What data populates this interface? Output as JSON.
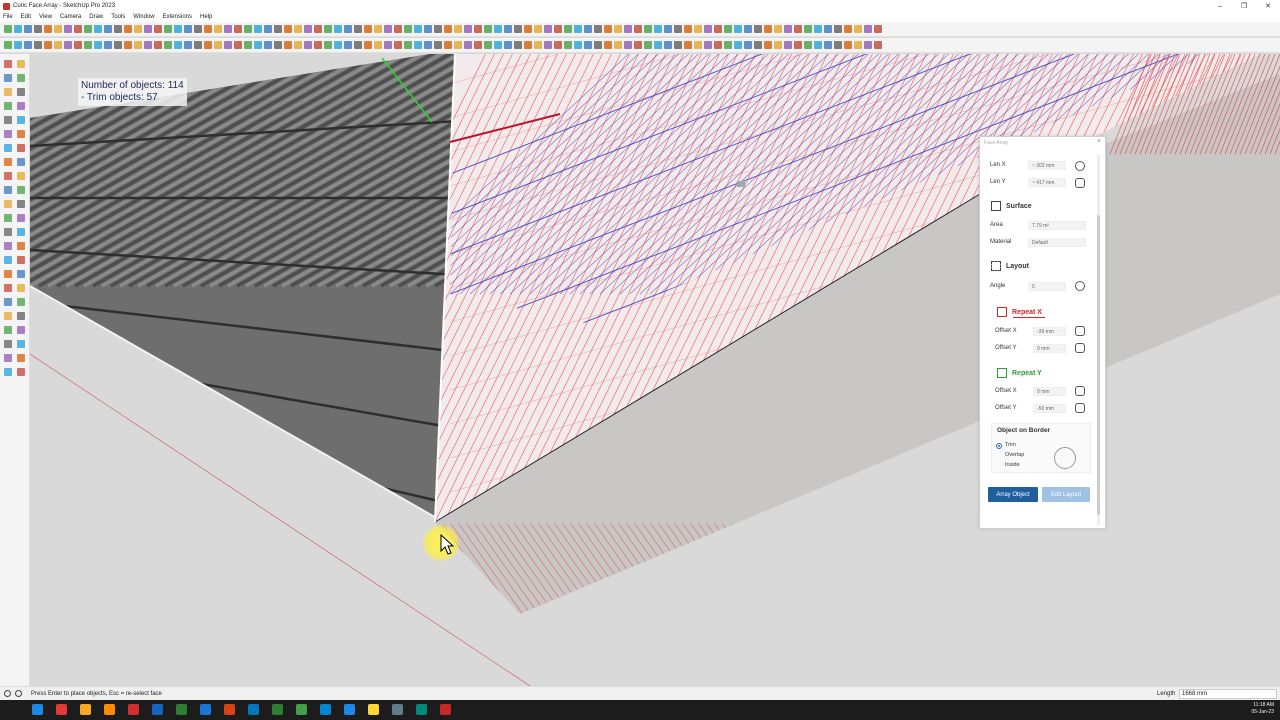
{
  "window": {
    "title": "Curic Face Array - SketchUp Pro 2023",
    "controls": [
      "–",
      "❐",
      "✕"
    ]
  },
  "menu": [
    "File",
    "Edit",
    "View",
    "Camera",
    "Draw",
    "Tools",
    "Window",
    "Extensions",
    "Help"
  ],
  "hud": {
    "line1": "Number of objects: 114",
    "line2": "- Trim objects: 57"
  },
  "panel": {
    "title": "Face Array",
    "len_x_label": "Len X",
    "len_x_value": "~ 302 mm",
    "len_y_label": "Len Y",
    "len_y_value": "~ 417 mm",
    "surface_heading": "Surface",
    "area_label": "Area",
    "area_value": "7.79 m²",
    "material_label": "Material",
    "material_value": "Default",
    "layout_heading": "Layout",
    "angle_label": "Angle",
    "angle_value": "0",
    "repeat_x": "Repeat X",
    "rx_offset_x_label": "Offset X",
    "rx_offset_x_value": "-39 mm",
    "rx_offset_y_label": "Offset Y",
    "rx_offset_y_value": "0 mm",
    "repeat_y": "Repeat Y",
    "ry_offset_x_label": "Offset X",
    "ry_offset_x_value": "0 mm",
    "ry_offset_y_label": "Offset Y",
    "ry_offset_y_value": "-50 mm",
    "border_heading": "Object on Border",
    "opt_trim": "Trim",
    "opt_overlap": "Overlap",
    "opt_inside": "Inside",
    "array_btn": "Array Object",
    "edit_btn": "Edit Layout",
    "colors": {
      "repeat_x": "#d0262b",
      "repeat_y": "#2e9e34",
      "primary_btn": "#1f5f9e",
      "disabled_btn": "#9fc1e4"
    }
  },
  "status": {
    "text": "Press Enter to place objects, Esc = re-select face",
    "length_label": "Length",
    "length_value": "1668 mm"
  },
  "clock": {
    "time": "11:18 AM",
    "date": "05-Jan-23"
  }
}
